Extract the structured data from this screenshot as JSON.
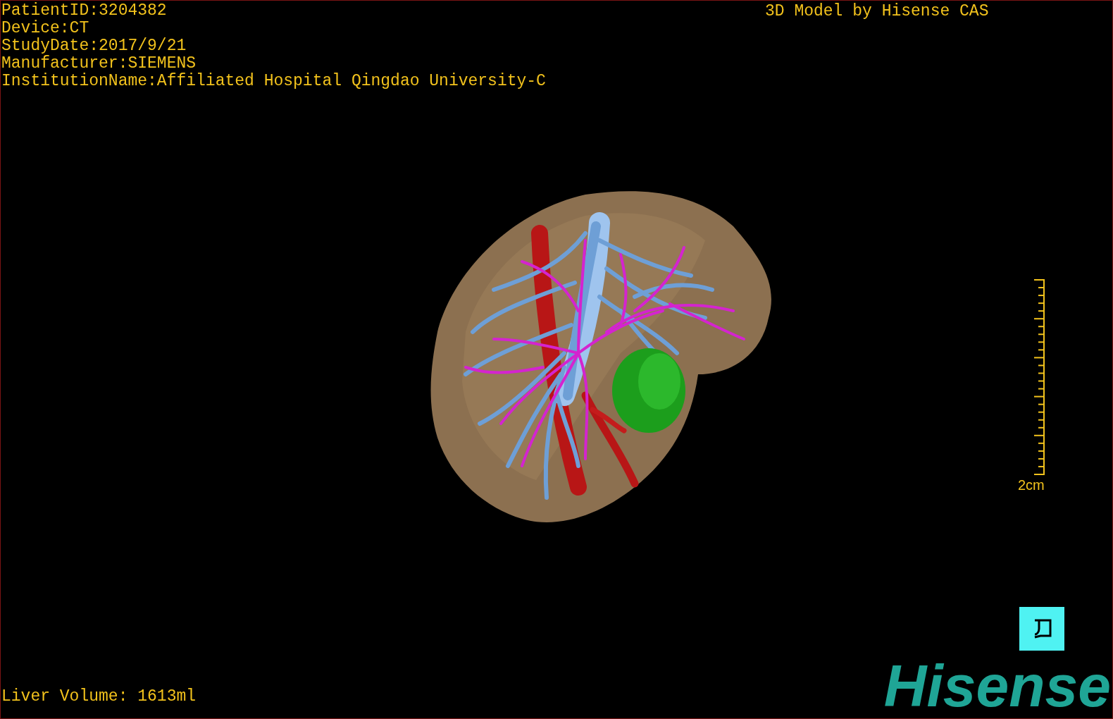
{
  "patient_info": [
    "PatientID:3204382",
    "Device:CT",
    "StudyDate:2017/9/21",
    "Manufacturer:SIEMENS",
    "InstitutionName:Affiliated Hospital Qingdao University-C"
  ],
  "title": "3D Model by Hisense CAS",
  "scale_bar": {
    "label": "2cm"
  },
  "liver_volume": "Liver Volume: 1613ml",
  "logo": "Hisense"
}
